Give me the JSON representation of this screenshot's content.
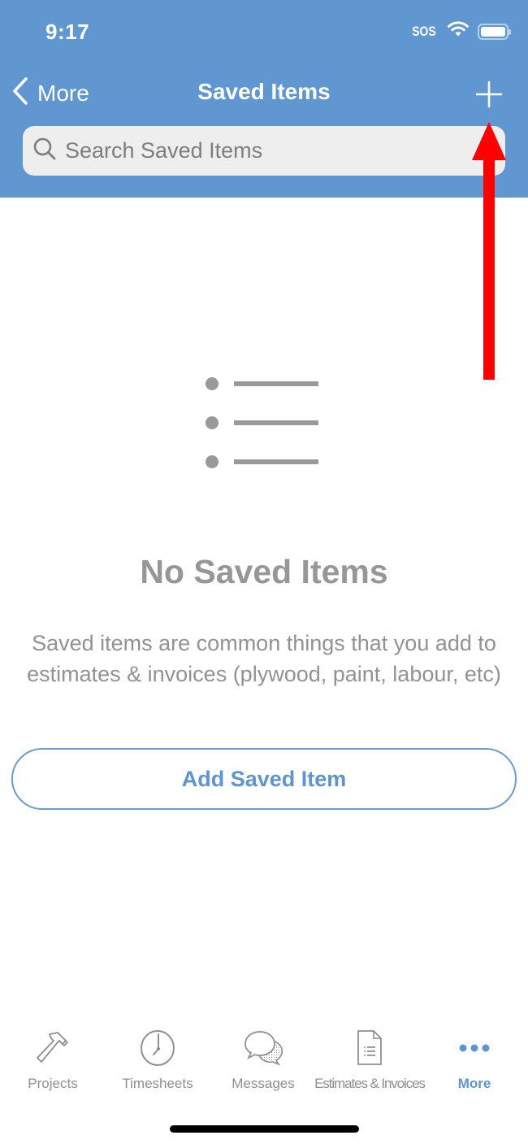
{
  "status_bar": {
    "time": "9:17",
    "carrier": "SOS",
    "icons": [
      "wifi-icon",
      "battery-icon"
    ]
  },
  "nav": {
    "back_label": "More",
    "title": "Saved Items",
    "add_icon": "plus-icon"
  },
  "search": {
    "placeholder": "Search Saved Items",
    "value": ""
  },
  "empty_state": {
    "icon": "list-icon",
    "title": "No Saved Items",
    "description": "Saved items are common things that you add to estimates & invoices (plywood, paint, labour, etc)",
    "button_label": "Add Saved Item"
  },
  "tab_bar": {
    "active_index": 4,
    "tabs": [
      {
        "label": "Projects",
        "icon": "hammer-icon"
      },
      {
        "label": "Timesheets",
        "icon": "clock-icon"
      },
      {
        "label": "Messages",
        "icon": "chat-bubbles-icon"
      },
      {
        "label": "Estimates & Invoices",
        "icon": "document-icon"
      },
      {
        "label": "More",
        "icon": "ellipsis-icon"
      }
    ]
  },
  "colors": {
    "header_bg": "#6097d1",
    "accent": "#5e95cf",
    "muted_text": "#929292",
    "annotation": "#ff0000"
  },
  "annotation": {
    "type": "arrow",
    "direction": "up",
    "points_to": "add-button"
  }
}
